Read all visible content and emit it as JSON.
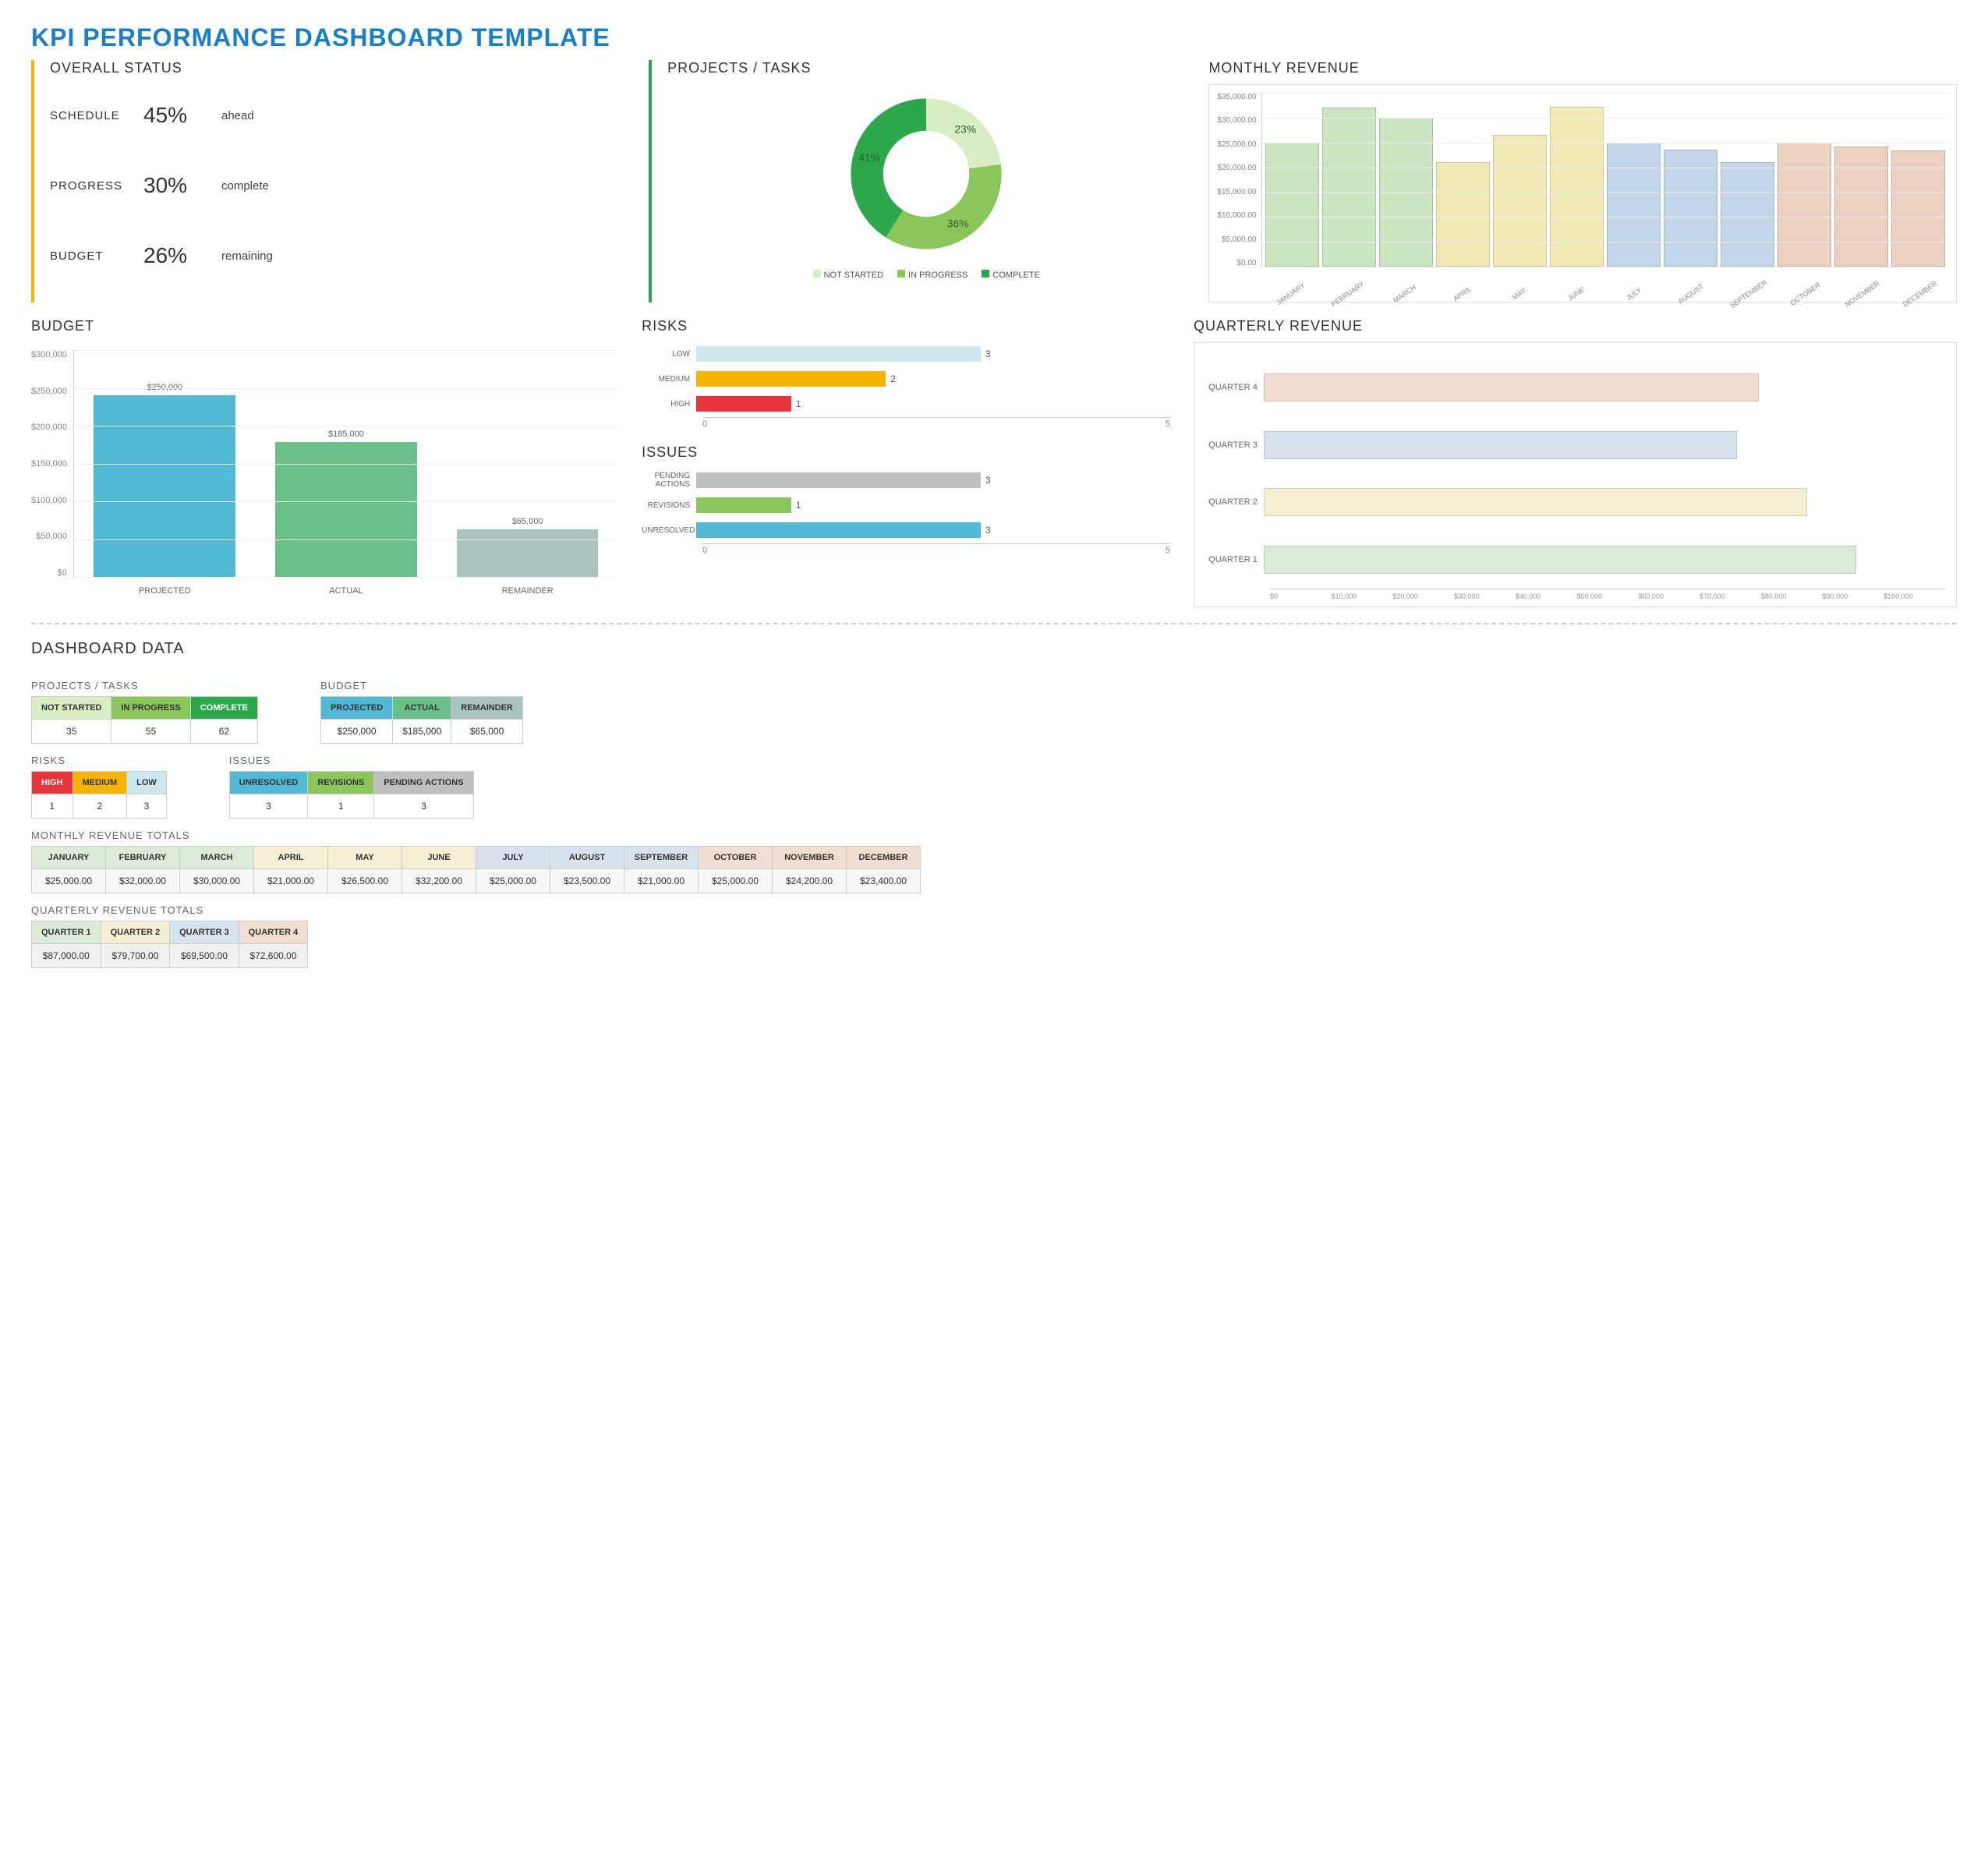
{
  "title": "KPI PERFORMANCE DASHBOARD TEMPLATE",
  "overall_status": {
    "heading": "OVERALL STATUS",
    "rows": [
      {
        "label": "SCHEDULE",
        "value": "45%",
        "desc": "ahead"
      },
      {
        "label": "PROGRESS",
        "value": "30%",
        "desc": "complete"
      },
      {
        "label": "BUDGET",
        "value": "26%",
        "desc": "remaining"
      }
    ]
  },
  "projects_tasks": {
    "heading": "PROJECTS / TASKS",
    "legend": [
      "NOT STARTED",
      "IN PROGRESS",
      "COMPLETE"
    ]
  },
  "monthly_revenue": {
    "heading": "MONTHLY REVENUE"
  },
  "budget": {
    "heading": "BUDGET"
  },
  "risks": {
    "heading": "RISKS"
  },
  "issues": {
    "heading": "ISSUES"
  },
  "quarterly_revenue": {
    "heading": "QUARTERLY REVENUE"
  },
  "dashboard_data": {
    "heading": "DASHBOARD DATA",
    "projects": {
      "heading": "PROJECTS / TASKS",
      "headers": [
        "NOT STARTED",
        "IN PROGRESS",
        "COMPLETE"
      ],
      "values": [
        "35",
        "55",
        "62"
      ],
      "colors": [
        "#d8edc4",
        "#8bc65a",
        "#2aa84a"
      ]
    },
    "budget": {
      "heading": "BUDGET",
      "headers": [
        "PROJECTED",
        "ACTUAL",
        "REMAINDER"
      ],
      "values": [
        "$250,000",
        "$185,000",
        "$65,000"
      ],
      "colors": [
        "#4fb9d6",
        "#6ac188",
        "#a9c4bf"
      ]
    },
    "risks": {
      "heading": "RISKS",
      "headers": [
        "HIGH",
        "MEDIUM",
        "LOW"
      ],
      "values": [
        "1",
        "2",
        "3"
      ],
      "colors": [
        "#e8343b",
        "#f5b400",
        "#cde7ee"
      ]
    },
    "issues": {
      "heading": "ISSUES",
      "headers": [
        "UNRESOLVED",
        "REVISIONS",
        "PENDING ACTIONS"
      ],
      "values": [
        "3",
        "1",
        "3"
      ],
      "colors": [
        "#4fb9d6",
        "#8bc65a",
        "#bfbfbf"
      ]
    },
    "monthly": {
      "heading": "MONTHLY REVENUE TOTALS",
      "headers": [
        "JANUARY",
        "FEBRUARY",
        "MARCH",
        "APRIL",
        "MAY",
        "JUNE",
        "JULY",
        "AUGUST",
        "SEPTEMBER",
        "OCTOBER",
        "NOVEMBER",
        "DECEMBER"
      ],
      "values": [
        "$25,000.00",
        "$32,000.00",
        "$30,000.00",
        "$21,000.00",
        "$26,500.00",
        "$32,200.00",
        "$25,000.00",
        "$23,500.00",
        "$21,000.00",
        "$25,000.00",
        "$24,200.00",
        "$23,400.00"
      ],
      "colors": [
        "#dcebd7",
        "#dcebd7",
        "#dcebd7",
        "#f5efd4",
        "#f5efd4",
        "#f5efd4",
        "#d7e2ec",
        "#d7e2ec",
        "#d7e2ec",
        "#f1ddd2",
        "#f1ddd2",
        "#f1ddd2"
      ]
    },
    "quarterly": {
      "heading": "QUARTERLY REVENUE TOTALS",
      "headers": [
        "QUARTER 1",
        "QUARTER 2",
        "QUARTER 3",
        "QUARTER 4"
      ],
      "values": [
        "$87,000.00",
        "$79,700.00",
        "$69,500.00",
        "$72,600.00"
      ],
      "colors": [
        "#dcebd7",
        "#f5efd4",
        "#d7e2ec",
        "#f1ddd2"
      ]
    }
  },
  "chart_data": [
    {
      "id": "projects_donut",
      "type": "pie",
      "series": [
        {
          "name": "NOT STARTED",
          "value": 23,
          "color": "#d8edc4"
        },
        {
          "name": "IN PROGRESS",
          "value": 36,
          "color": "#8bc65a"
        },
        {
          "name": "COMPLETE",
          "value": 41,
          "color": "#2aa84a"
        }
      ],
      "labels": [
        "23%",
        "36%",
        "41%"
      ]
    },
    {
      "id": "monthly_revenue",
      "type": "bar",
      "categories": [
        "JANUARY",
        "FEBRUARY",
        "MARCH",
        "APRIL",
        "MAY",
        "JUNE",
        "JULY",
        "AUGUST",
        "SEPTEMBER",
        "OCTOBER",
        "NOVEMBER",
        "DECEMBER"
      ],
      "values": [
        25000,
        32000,
        30000,
        21000,
        26500,
        32200,
        25000,
        23500,
        21000,
        25000,
        24200,
        23400
      ],
      "colors": [
        "#c9e6c0",
        "#c9e6c0",
        "#c9e6c0",
        "#f3e9b5",
        "#f3e9b5",
        "#f3e9b5",
        "#c1d6e8",
        "#c1d6e8",
        "#c1d6e8",
        "#ecd1c0",
        "#ecd1c0",
        "#ecd1c0"
      ],
      "ylim": [
        0,
        35000
      ],
      "yticks": [
        "$0.00",
        "$5,000.00",
        "$10,000.00",
        "$15,000.00",
        "$20,000.00",
        "$25,000.00",
        "$30,000.00",
        "$35,000.00"
      ]
    },
    {
      "id": "budget",
      "type": "bar",
      "categories": [
        "PROJECTED",
        "ACTUAL",
        "REMAINDER"
      ],
      "values": [
        250000,
        185000,
        65000
      ],
      "display": [
        "$250,000",
        "$185,000",
        "$65,000"
      ],
      "colors": [
        "#4fb9d6",
        "#6ac188",
        "#a9c4bf"
      ],
      "ylim": [
        0,
        300000
      ],
      "yticks": [
        "$0",
        "$50,000",
        "$100,000",
        "$150,000",
        "$200,000",
        "$250,000",
        "$300,000"
      ]
    },
    {
      "id": "risks",
      "type": "bar",
      "orientation": "h",
      "categories": [
        "LOW",
        "MEDIUM",
        "HIGH"
      ],
      "values": [
        3,
        2,
        1
      ],
      "colors": [
        "#cde7ee",
        "#f5b400",
        "#e8343b"
      ],
      "xlim": [
        0,
        5
      ]
    },
    {
      "id": "issues",
      "type": "bar",
      "orientation": "h",
      "categories": [
        "PENDING ACTIONS",
        "REVISIONS",
        "UNRESOLVED"
      ],
      "values": [
        3,
        1,
        3
      ],
      "colors": [
        "#bfbfbf",
        "#8bc65a",
        "#4fb9d6"
      ],
      "xlim": [
        0,
        5
      ]
    },
    {
      "id": "quarterly_revenue",
      "type": "bar",
      "orientation": "h",
      "categories": [
        "QUARTER 4",
        "QUARTER 3",
        "QUARTER 2",
        "QUARTER 1"
      ],
      "values": [
        72600,
        69500,
        79700,
        87000
      ],
      "colors": [
        "#f1ddd2",
        "#d7e2ec",
        "#f5efd4",
        "#dcebd7"
      ],
      "xlim": [
        0,
        100000
      ],
      "xticks": [
        "$0",
        "$10,000",
        "$20,000",
        "$30,000",
        "$40,000",
        "$50,000",
        "$60,000",
        "$70,000",
        "$80,000",
        "$90,000",
        "$100,000"
      ]
    }
  ]
}
